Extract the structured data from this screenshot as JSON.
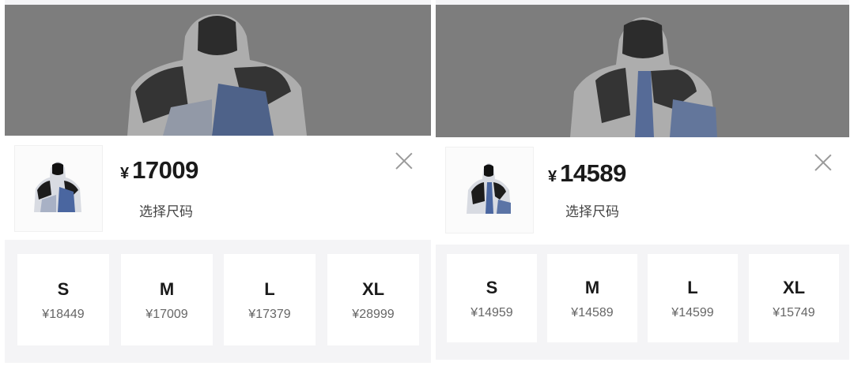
{
  "panels": [
    {
      "price_currency": "¥",
      "price": "17009",
      "select_label": "选择尺码",
      "sizes": [
        {
          "size": "S",
          "price": "¥18449"
        },
        {
          "size": "M",
          "price": "¥17009"
        },
        {
          "size": "L",
          "price": "¥17379"
        },
        {
          "size": "XL",
          "price": "¥28999"
        }
      ]
    },
    {
      "price_currency": "¥",
      "price": "14589",
      "select_label": "选择尺码",
      "sizes": [
        {
          "size": "S",
          "price": "¥14959"
        },
        {
          "size": "M",
          "price": "¥14589"
        },
        {
          "size": "L",
          "price": "¥14599"
        },
        {
          "size": "XL",
          "price": "¥15749"
        }
      ]
    }
  ],
  "colors": {
    "hero_overlay": "#7d7d7d",
    "sheet_bg": "#ffffff",
    "size_area_bg": "#f4f4f6",
    "text_dark": "#1a1a1a",
    "text_muted": "#666666"
  },
  "icons": {
    "close": "close-icon",
    "product": "jacket-image"
  }
}
